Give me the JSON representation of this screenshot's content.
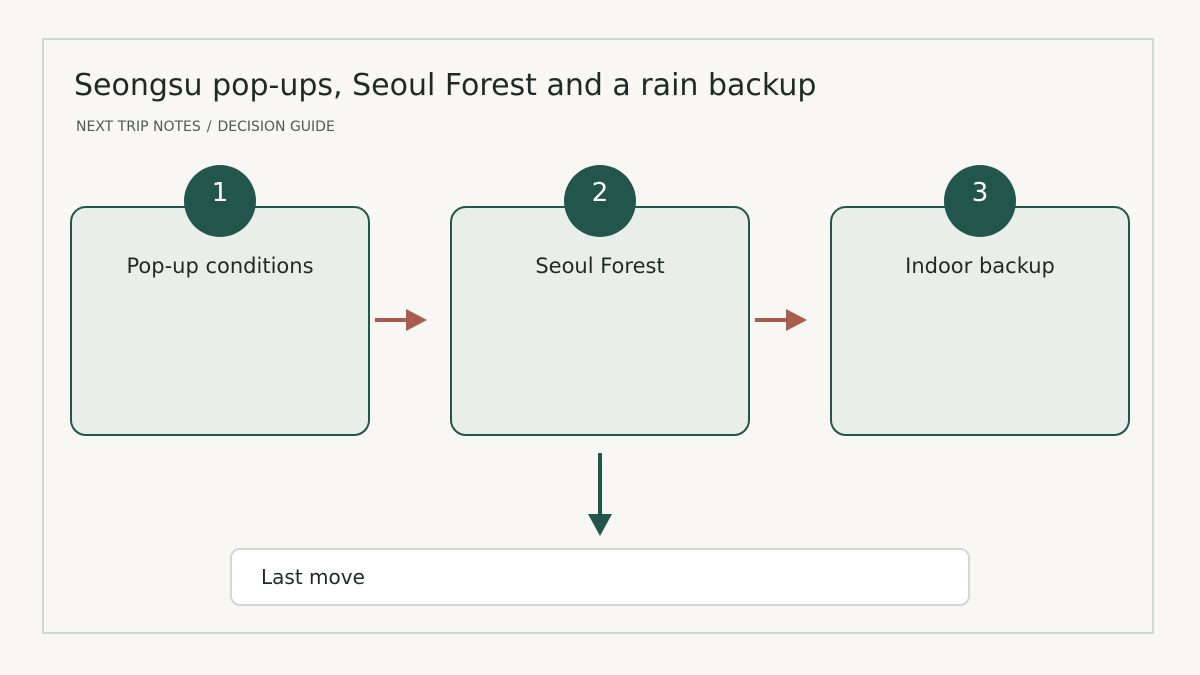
{
  "title": "Seongsu pop-ups, Seoul Forest and a rain backup",
  "subtitle": {
    "section": "NEXT TRIP NOTES",
    "separator": "/",
    "page": "DECISION GUIDE"
  },
  "steps": [
    {
      "number": "1",
      "label": "Pop-up conditions"
    },
    {
      "number": "2",
      "label": "Seoul Forest"
    },
    {
      "number": "3",
      "label": "Indoor backup"
    }
  ],
  "final_step": {
    "label": "Last move"
  },
  "colors": {
    "accent": "#23564b",
    "arrow_side": "#a85c4d",
    "box_fill": "#e9eeea",
    "background": "#f8f7f3"
  }
}
